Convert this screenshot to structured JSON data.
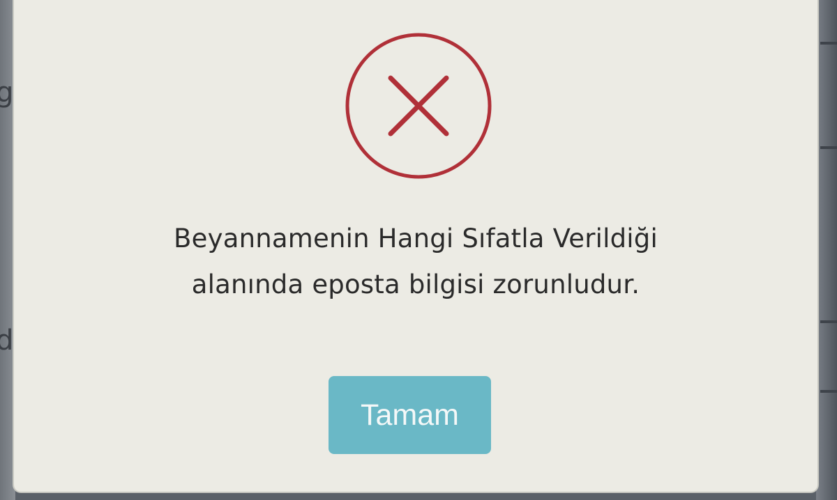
{
  "background": {
    "left_fragments": [
      "g",
      "d"
    ]
  },
  "dialog": {
    "icon": "error-x-circle-icon",
    "message_line_1": "Beyannamenin Hangi Sıfatla Verildiği",
    "message_line_2": "alanında eposta bilgisi zorunludur.",
    "ok_label": "Tamam"
  },
  "colors": {
    "icon": "#b03038",
    "button": "#6ab8c6",
    "dialog_bg": "#ecebe4",
    "text": "#2a2a2a"
  }
}
